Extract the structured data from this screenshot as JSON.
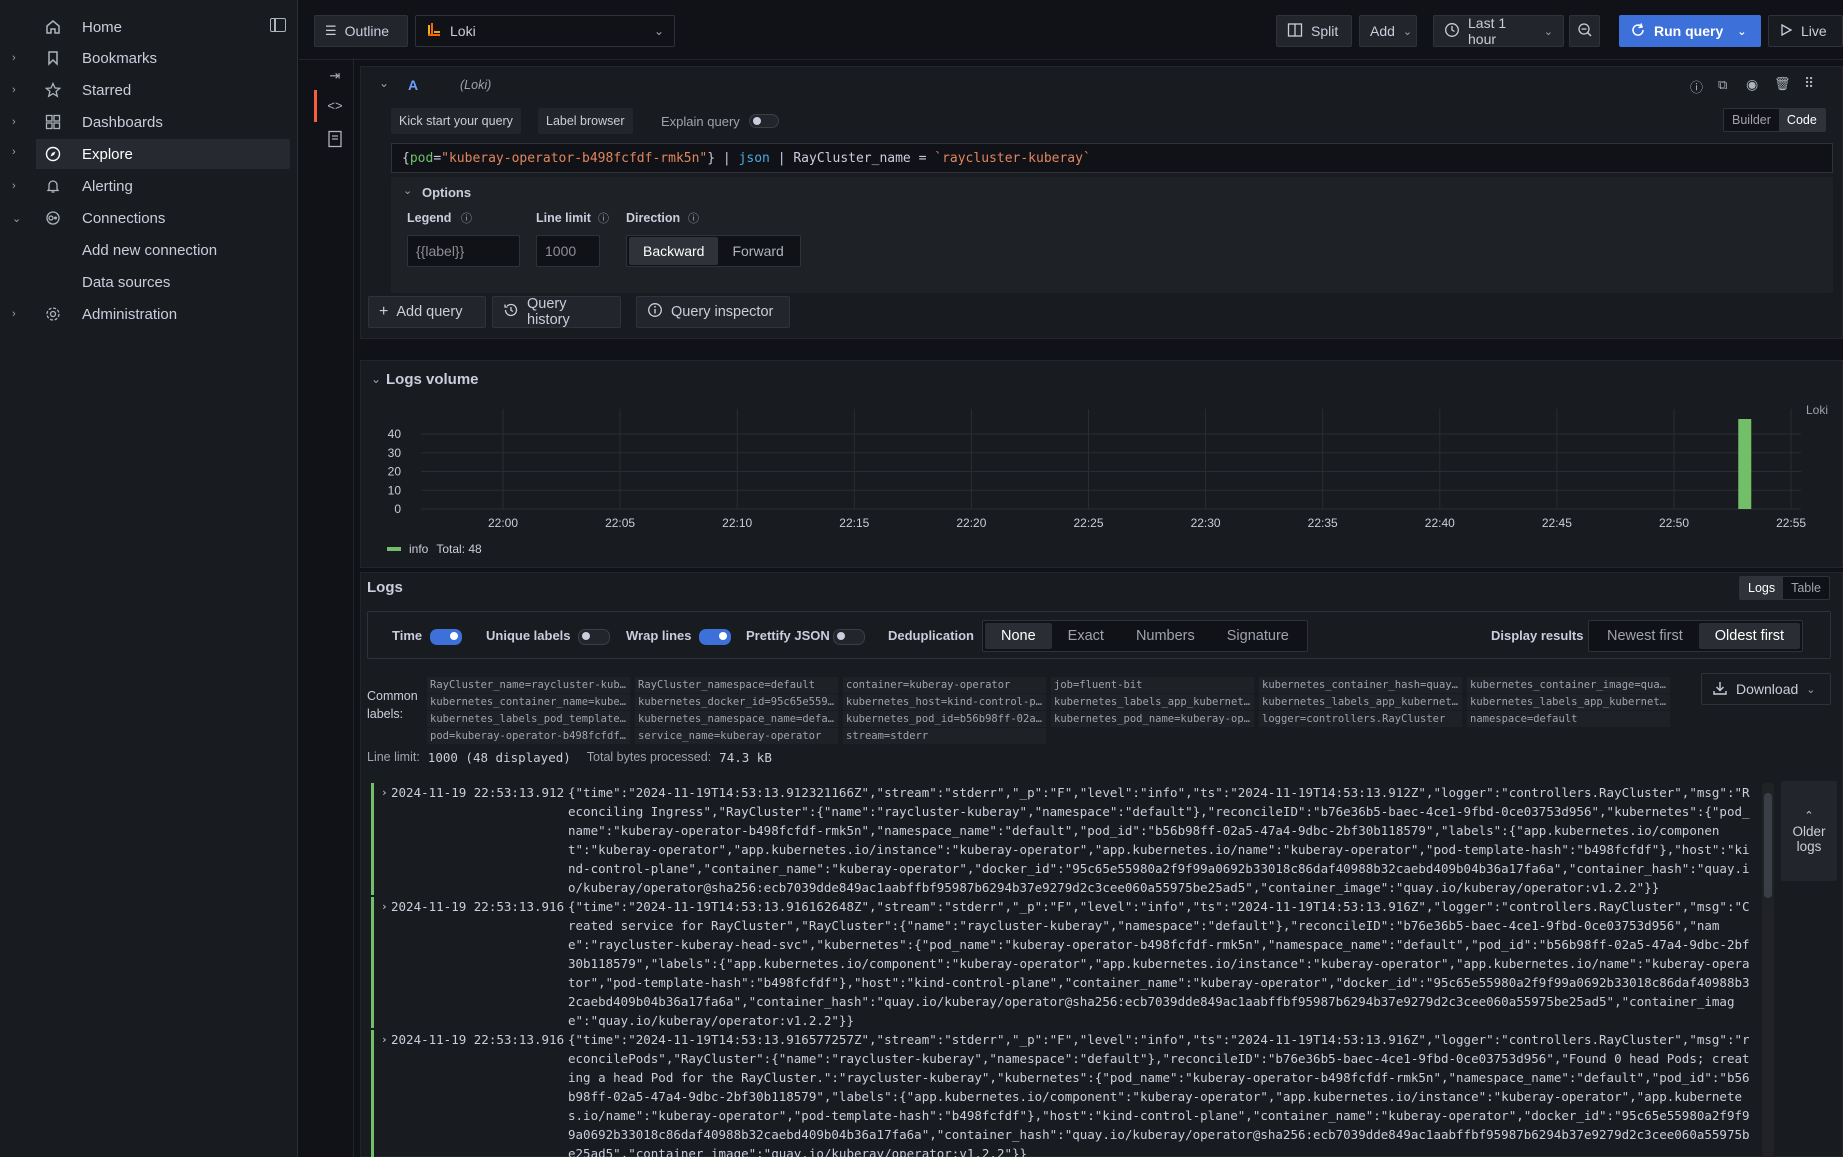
{
  "nav": {
    "items": [
      {
        "label": "Home",
        "icon": "home-icon",
        "chevron": false
      },
      {
        "label": "Bookmarks",
        "icon": "bookmark-icon",
        "chevron": true
      },
      {
        "label": "Starred",
        "icon": "star-icon",
        "chevron": true
      },
      {
        "label": "Dashboards",
        "icon": "dashboards-icon",
        "chevron": true
      },
      {
        "label": "Explore",
        "icon": "compass-icon",
        "chevron": true,
        "active": true
      },
      {
        "label": "Alerting",
        "icon": "bell-icon",
        "chevron": true
      },
      {
        "label": "Connections",
        "icon": "connections-icon",
        "chevron": true,
        "expanded": true
      },
      {
        "label": "Add new connection",
        "sub": true
      },
      {
        "label": "Data sources",
        "sub": true
      },
      {
        "label": "Administration",
        "icon": "gear-icon",
        "chevron": true
      }
    ]
  },
  "toolbar": {
    "outline_label": "Outline",
    "datasource": "Loki",
    "split_label": "Split",
    "add_label": "Add",
    "time_range": "Last 1 hour",
    "run_label": "Run query",
    "live_label": "Live"
  },
  "query": {
    "ref_id": "A",
    "datasource_tag": "(Loki)",
    "kick_start_label": "Kick start your query",
    "label_browser_label": "Label browser",
    "explain_label": "Explain query",
    "mode_builder": "Builder",
    "mode_code": "Code",
    "expr": {
      "open": "{",
      "key": "pod",
      "eq": "=",
      "value": "\"kuberay-operator-b498fcfdf-rmk5n\"",
      "close": "}",
      "pipe1": " | ",
      "json": "json",
      "pipe2": " | ",
      "filter": "RayCluster_name = ",
      "filter_value": "`raycluster-kuberay`"
    },
    "options_label": "Options",
    "legend_label": "Legend",
    "legend_placeholder": "{{label}}",
    "line_limit_label": "Line limit",
    "line_limit_placeholder": "1000",
    "direction_label": "Direction",
    "direction_backward": "Backward",
    "direction_forward": "Forward",
    "add_query_label": "Add query",
    "history_label": "Query history",
    "inspector_label": "Query inspector"
  },
  "volume": {
    "title": "Logs volume",
    "datasource_label": "Loki",
    "legend_name": "info",
    "legend_total": "Total: 48",
    "series_color": "#73bf69"
  },
  "chart_data": {
    "type": "bar",
    "title": "Logs volume",
    "xlabel": "",
    "ylabel": "",
    "x_ticks": [
      "22:00",
      "22:05",
      "22:10",
      "22:15",
      "22:20",
      "22:25",
      "22:30",
      "22:35",
      "22:40",
      "22:45",
      "22:50",
      "22:55"
    ],
    "y_ticks": [
      0,
      10,
      20,
      30,
      40
    ],
    "ylim": [
      0,
      48
    ],
    "series": [
      {
        "name": "info",
        "points": [
          {
            "x": "22:53",
            "y": 48
          }
        ]
      }
    ]
  },
  "logs": {
    "title": "Logs",
    "view_logs": "Logs",
    "view_table": "Table",
    "time_label": "Time",
    "unique_labels_label": "Unique labels",
    "wrap_lines_label": "Wrap lines",
    "prettify_label": "Prettify JSON",
    "dedup_label": "Deduplication",
    "dedup_options": [
      "None",
      "Exact",
      "Numbers",
      "Signature"
    ],
    "display_results_label": "Display results",
    "newest_first": "Newest first",
    "oldest_first": "Oldest first",
    "common_label_1": "Common",
    "common_label_2": "labels:",
    "download_label": "Download",
    "common_labels": [
      "RayCluster_name=raycluster-kube…",
      "RayCluster_namespace=default",
      "container=kuberay-operator",
      "job=fluent-bit",
      "kubernetes_container_hash=quay.…",
      "kubernetes_container_image=quay…",
      "kubernetes_container_name=kuber…",
      "kubernetes_docker_id=95c65e5598…",
      "kubernetes_host=kind-control-pl…",
      "kubernetes_labels_app_kubernete…",
      "kubernetes_labels_app_kubernete…",
      "kubernetes_labels_app_kubernete…",
      "kubernetes_labels_pod_template_…",
      "kubernetes_namespace_name=defau…",
      "kubernetes_pod_id=b56b98ff-02a5…",
      "kubernetes_pod_name=kuberay-ope…",
      "logger=controllers.RayCluster",
      "namespace=default",
      "pod=kuberay-operator-b498fcfdf-…",
      "service_name=kuberay-operator",
      "stream=stderr"
    ],
    "line_limit_label": "Line limit:",
    "line_limit_value": "1000 (48 displayed)",
    "bytes_label": "Total bytes processed:",
    "bytes_value": "74.3 kB",
    "older_logs_1": "Older",
    "older_logs_2": "logs",
    "lines": [
      {
        "ts": "2024-11-19 22:53:13.912",
        "msg": "{\"time\":\"2024-11-19T14:53:13.912321166Z\",\"stream\":\"stderr\",\"_p\":\"F\",\"level\":\"info\",\"ts\":\"2024-11-19T14:53:13.912Z\",\"logger\":\"controllers.RayCluster\",\"msg\":\"Reconciling Ingress\",\"RayCluster\":{\"name\":\"raycluster-kuberay\",\"namespace\":\"default\"},\"reconcileID\":\"b76e36b5-baec-4ce1-9fbd-0ce03753d956\",\"kubernetes\":{\"pod_name\":\"kuberay-operator-b498fcfdf-rmk5n\",\"namespace_name\":\"default\",\"pod_id\":\"b56b98ff-02a5-47a4-9dbc-2bf30b118579\",\"labels\":{\"app.kubernetes.io/component\":\"kuberay-operator\",\"app.kubernetes.io/instance\":\"kuberay-operator\",\"app.kubernetes.io/name\":\"kuberay-operator\",\"pod-template-hash\":\"b498fcfdf\"},\"host\":\"kind-control-plane\",\"container_name\":\"kuberay-operator\",\"docker_id\":\"95c65e55980a2f9f99a0692b33018c86daf40988b32caebd409b04b36a17fa6a\",\"container_hash\":\"quay.io/kuberay/operator@sha256:ecb7039dde849ac1aabffbf95987b6294b37e9279d2c3cee060a55975be25ad5\",\"container_image\":\"quay.io/kuberay/operator:v1.2.2\"}}"
      },
      {
        "ts": "2024-11-19 22:53:13.916",
        "msg": "{\"time\":\"2024-11-19T14:53:13.916162648Z\",\"stream\":\"stderr\",\"_p\":\"F\",\"level\":\"info\",\"ts\":\"2024-11-19T14:53:13.916Z\",\"logger\":\"controllers.RayCluster\",\"msg\":\"Created service for RayCluster\",\"RayCluster\":{\"name\":\"raycluster-kuberay\",\"namespace\":\"default\"},\"reconcileID\":\"b76e36b5-baec-4ce1-9fbd-0ce03753d956\",\"name\":\"raycluster-kuberay-head-svc\",\"kubernetes\":{\"pod_name\":\"kuberay-operator-b498fcfdf-rmk5n\",\"namespace_name\":\"default\",\"pod_id\":\"b56b98ff-02a5-47a4-9dbc-2bf30b118579\",\"labels\":{\"app.kubernetes.io/component\":\"kuberay-operator\",\"app.kubernetes.io/instance\":\"kuberay-operator\",\"app.kubernetes.io/name\":\"kuberay-operator\",\"pod-template-hash\":\"b498fcfdf\"},\"host\":\"kind-control-plane\",\"container_name\":\"kuberay-operator\",\"docker_id\":\"95c65e55980a2f9f99a0692b33018c86daf40988b32caebd409b04b36a17fa6a\",\"container_hash\":\"quay.io/kuberay/operator@sha256:ecb7039dde849ac1aabffbf95987b6294b37e9279d2c3cee060a55975be25ad5\",\"container_image\":\"quay.io/kuberay/operator:v1.2.2\"}}"
      },
      {
        "ts": "2024-11-19 22:53:13.916",
        "msg": "{\"time\":\"2024-11-19T14:53:13.916577257Z\",\"stream\":\"stderr\",\"_p\":\"F\",\"level\":\"info\",\"ts\":\"2024-11-19T14:53:13.916Z\",\"logger\":\"controllers.RayCluster\",\"msg\":\"reconcilePods\",\"RayCluster\":{\"name\":\"raycluster-kuberay\",\"namespace\":\"default\"},\"reconcileID\":\"b76e36b5-baec-4ce1-9fbd-0ce03753d956\",\"Found 0 head Pods; creating a head Pod for the RayCluster.\":\"raycluster-kuberay\",\"kubernetes\":{\"pod_name\":\"kuberay-operator-b498fcfdf-rmk5n\",\"namespace_name\":\"default\",\"pod_id\":\"b56b98ff-02a5-47a4-9dbc-2bf30b118579\",\"labels\":{\"app.kubernetes.io/component\":\"kuberay-operator\",\"app.kubernetes.io/instance\":\"kuberay-operator\",\"app.kubernetes.io/name\":\"kuberay-operator\",\"pod-template-hash\":\"b498fcfdf\"},\"host\":\"kind-control-plane\",\"container_name\":\"kuberay-operator\",\"docker_id\":\"95c65e55980a2f9f99a0692b33018c86daf40988b32caebd409b04b36a17fa6a\",\"container_hash\":\"quay.io/kuberay/operator@sha256:ecb7039dde849ac1aabffbf95987b6294b37e9279d2c3cee060a55975be25ad5\",\"container_image\":\"quay.io/kuberay/operator:v1.2.2\"}}"
      }
    ]
  }
}
